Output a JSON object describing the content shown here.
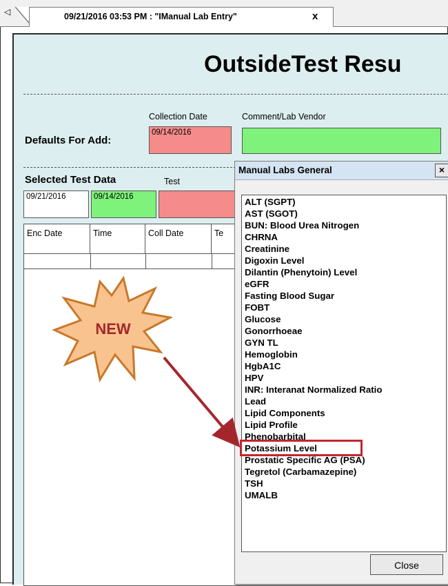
{
  "tab": {
    "scroll_arrow": "◁",
    "title": "09/21/2016 03:53 PM : \"IManual Lab Entry\"",
    "close": "x"
  },
  "main": {
    "title": "OutsideTest Resu",
    "defaults": {
      "label": "Defaults For Add:",
      "collection_date_label": "Collection Date",
      "comment_label": "Comment/Lab Vendor",
      "collection_date_value": "09/14/2016",
      "comment_value": ""
    },
    "selected": {
      "label": "Selected Test Data",
      "test_label": "Test",
      "enc_date": "09/21/2016",
      "coll_date": "09/14/2016"
    },
    "grid": {
      "columns": [
        "Enc Date",
        "Time",
        "Coll Date",
        "Te"
      ]
    }
  },
  "callout": {
    "text": "NEW",
    "colors": {
      "fill": "#f9c38f",
      "stroke": "#c8782a",
      "arrow": "#a4262c"
    }
  },
  "dialog": {
    "title": "Manual Labs General",
    "close_glyph": "×",
    "items": [
      "ALT (SGPT)",
      "AST (SGOT)",
      "BUN: Blood Urea Nitrogen",
      "CHRNA",
      "Creatinine",
      "Digoxin Level",
      "Dilantin (Phenytoin) Level",
      "eGFR",
      "Fasting Blood Sugar",
      "FOBT",
      "Glucose",
      "Gonorrhoeae",
      "GYN TL",
      "Hemoglobin",
      "HgbA1C",
      "HPV",
      "INR: Interanat Normalized Ratio",
      "Lead",
      "Lipid Components",
      "Lipid Profile",
      "Phenobarbital",
      "Potassium Level",
      "Prostatic Specific AG (PSA)",
      "Tegretol (Carbamazepine)",
      "TSH",
      "UMALB"
    ],
    "highlighted_item": "Lipid Components",
    "close_button": "Close"
  },
  "colors": {
    "pink": "#f68b8b",
    "green": "#7ef27a",
    "window_bg": "#ddeef0",
    "highlight": "#c1272d"
  }
}
